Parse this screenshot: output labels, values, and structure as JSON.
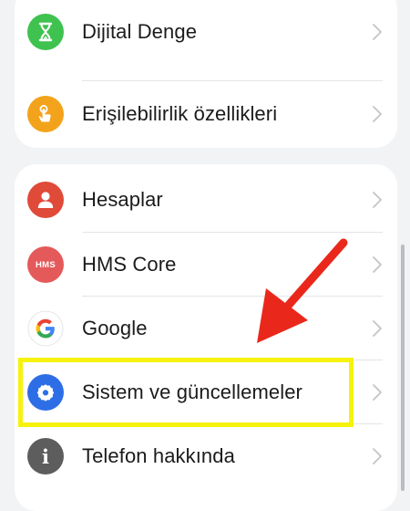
{
  "settings": {
    "group1": [
      {
        "label": "Dijital Denge",
        "icon": "hourglass-icon",
        "icon_color": "#3fc24f"
      },
      {
        "label": "Erişilebilirlik özellikleri",
        "icon": "accessibility-hand-icon",
        "icon_color": "#f3a31b"
      }
    ],
    "group2": [
      {
        "label": "Hesaplar",
        "icon": "user-icon",
        "icon_color": "#e04a38"
      },
      {
        "label": "HMS Core",
        "icon": "hms-core-icon",
        "icon_color": "#e45a5a",
        "icon_text": "HMS"
      },
      {
        "label": "Google",
        "icon": "google-icon"
      },
      {
        "label": "Sistem ve güncellemeler",
        "icon": "gear-icon",
        "icon_color": "#2d6ee6"
      },
      {
        "label": "Telefon hakkında",
        "icon": "info-icon",
        "icon_color": "#5d5d5d",
        "icon_text": "i"
      }
    ]
  },
  "annotation": {
    "highlight_color": "#f6f20b",
    "arrow_color": "#e9281b"
  }
}
